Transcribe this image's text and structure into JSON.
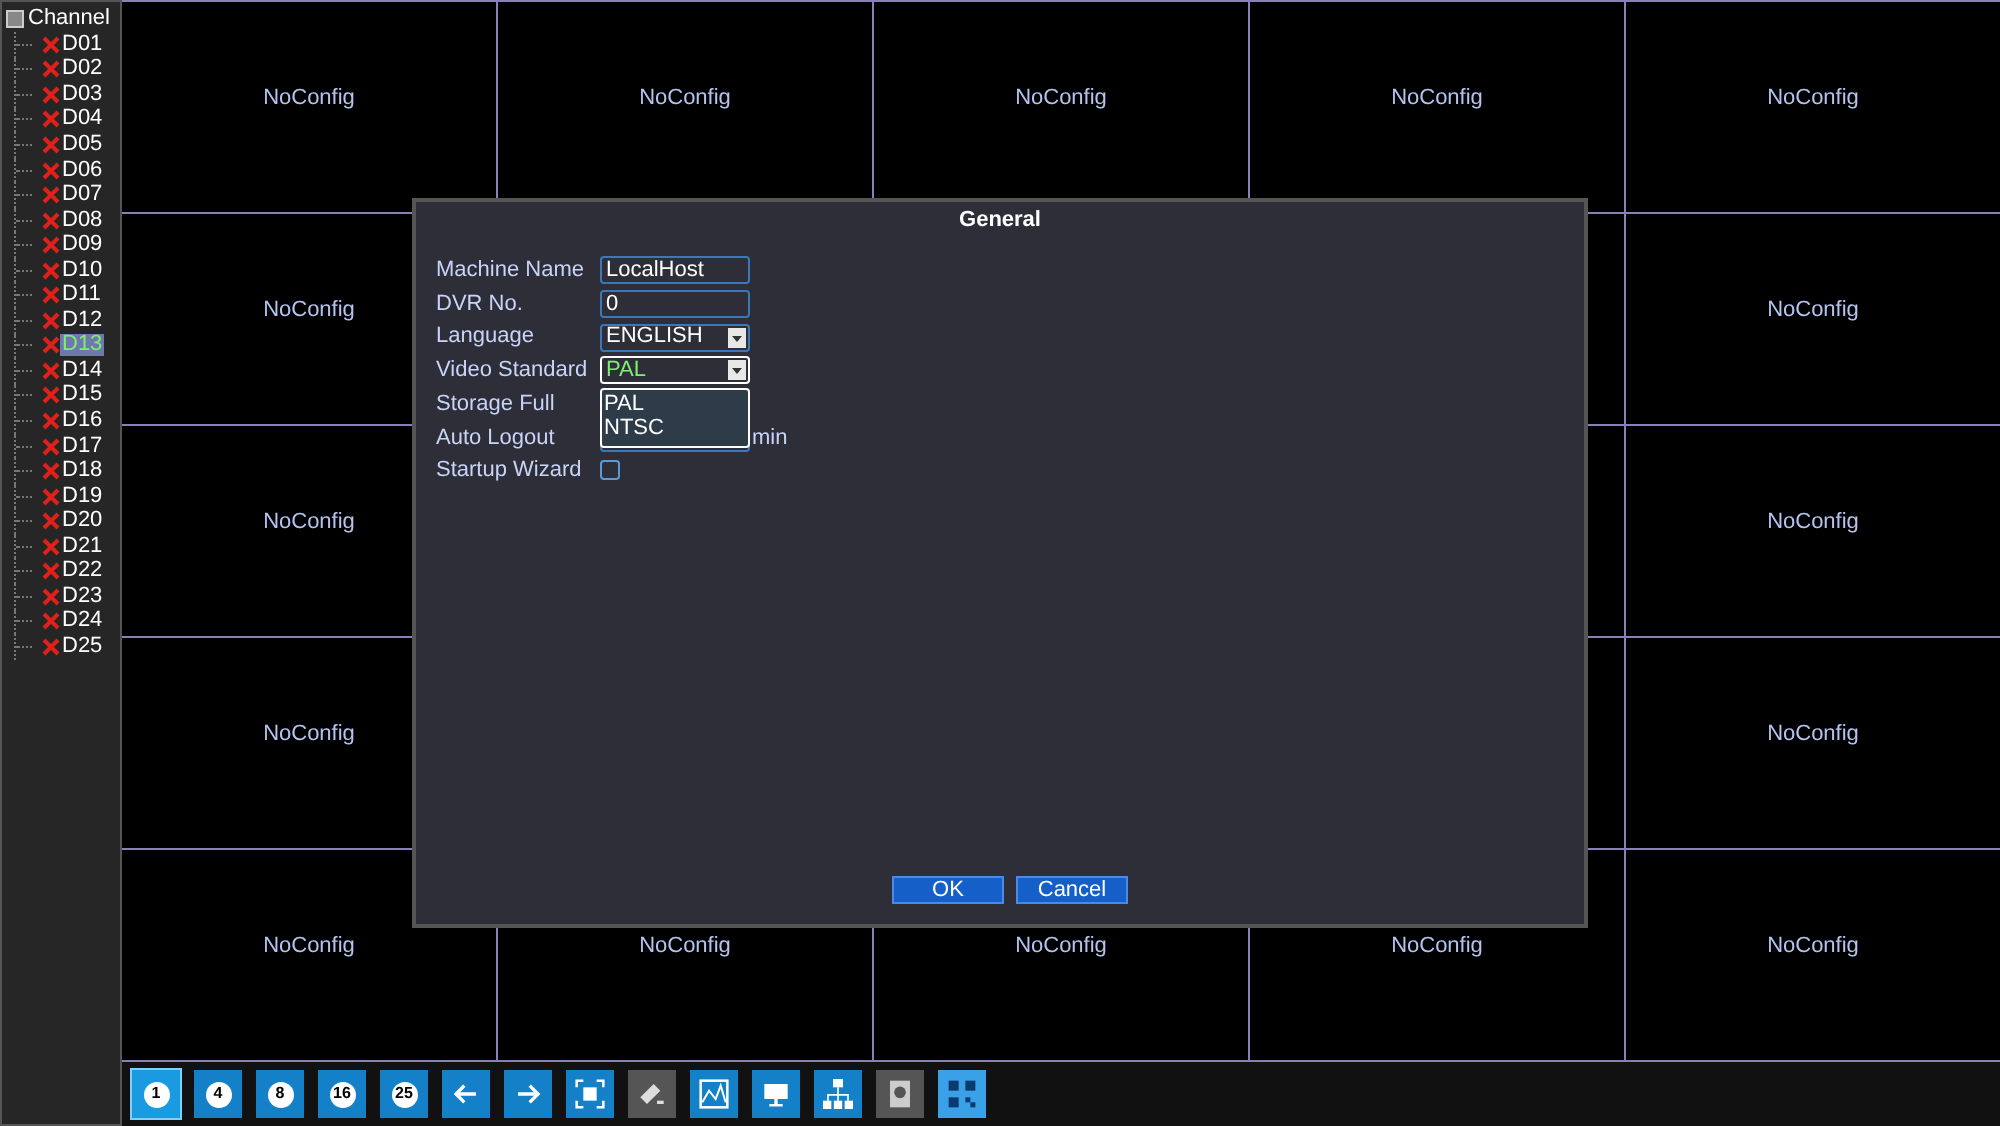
{
  "channel_tree": {
    "label": "Channel",
    "children": [
      {
        "label": "D01",
        "selected": false
      },
      {
        "label": "D02",
        "selected": false
      },
      {
        "label": "D03",
        "selected": false
      },
      {
        "label": "D04",
        "selected": false
      },
      {
        "label": "D05",
        "selected": false
      },
      {
        "label": "D06",
        "selected": false
      },
      {
        "label": "D07",
        "selected": false
      },
      {
        "label": "D08",
        "selected": false
      },
      {
        "label": "D09",
        "selected": false
      },
      {
        "label": "D10",
        "selected": false
      },
      {
        "label": "D11",
        "selected": false
      },
      {
        "label": "D12",
        "selected": false
      },
      {
        "label": "D13",
        "selected": true
      },
      {
        "label": "D14",
        "selected": false
      },
      {
        "label": "D15",
        "selected": false
      },
      {
        "label": "D16",
        "selected": false
      },
      {
        "label": "D17",
        "selected": false
      },
      {
        "label": "D18",
        "selected": false
      },
      {
        "label": "D19",
        "selected": false
      },
      {
        "label": "D20",
        "selected": false
      },
      {
        "label": "D21",
        "selected": false
      },
      {
        "label": "D22",
        "selected": false
      },
      {
        "label": "D23",
        "selected": false
      },
      {
        "label": "D24",
        "selected": false
      },
      {
        "label": "D25",
        "selected": false
      }
    ]
  },
  "video_grid": {
    "rows": [
      [
        "NoConfig",
        "NoConfig",
        "NoConfig",
        "NoConfig",
        "NoConfig"
      ],
      [
        "NoConfig",
        "NoConfig"
      ],
      [
        "NoConfig",
        "NoConfig"
      ],
      [
        "NoConfig",
        "NoConfig"
      ],
      [
        "NoConfig",
        "NoConfig",
        "NoConfig",
        "NoConfig",
        "NoConfig"
      ]
    ]
  },
  "dialog": {
    "title": "General",
    "fields": [
      {
        "label": "Machine Name",
        "kind": "text",
        "value": "LocalHost",
        "focused": false
      },
      {
        "label": "DVR No.",
        "kind": "text",
        "value": "0",
        "focused": false
      },
      {
        "label": "Language",
        "kind": "select",
        "value": "ENGLISH",
        "focused": false
      },
      {
        "label": "Video Standard",
        "kind": "select",
        "value": "PAL",
        "focused": true
      },
      {
        "label": "Storage Full",
        "kind": "label"
      },
      {
        "label": "Auto Logout",
        "kind": "text",
        "suffix": "min",
        "focused": false
      },
      {
        "label": "Startup Wizard",
        "kind": "checkbox",
        "checked": false
      }
    ],
    "dropdown": {
      "options": [
        "PAL",
        "NTSC"
      ]
    },
    "buttons": [
      "OK",
      "Cancel"
    ]
  },
  "toolbar": {
    "layouts": [
      {
        "label": "1",
        "selected": true
      },
      {
        "label": "4",
        "selected": false
      },
      {
        "label": "8",
        "selected": false
      },
      {
        "label": "16",
        "selected": false
      },
      {
        "label": "25",
        "selected": false
      }
    ],
    "tools": [
      {
        "disabled": false
      },
      {
        "disabled": false
      },
      {
        "disabled": false
      },
      {
        "disabled": true
      },
      {
        "disabled": false
      },
      {
        "disabled": false
      },
      {
        "disabled": false
      },
      {
        "disabled": true
      },
      {
        "disabled": false
      }
    ]
  }
}
